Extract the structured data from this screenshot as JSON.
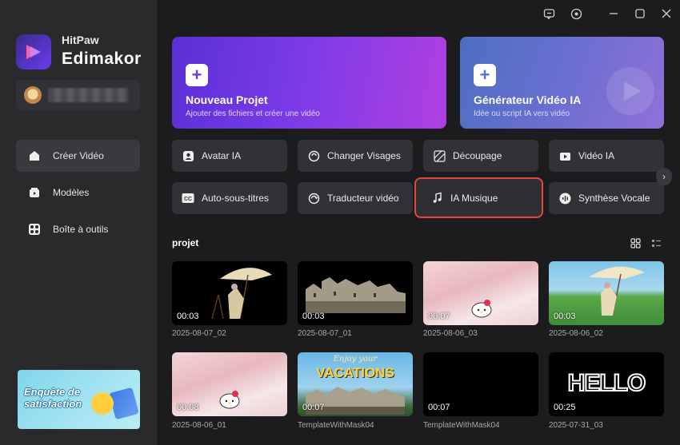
{
  "app": {
    "brand_line1": "HitPaw",
    "brand_line2": "Edimakor"
  },
  "sidebar": {
    "items": [
      {
        "label": "Créer Vidéo",
        "icon": "home-icon",
        "active": true
      },
      {
        "label": "Modèles",
        "icon": "templates-icon",
        "active": false
      },
      {
        "label": "Boîte à outils",
        "icon": "toolbox-icon",
        "active": false
      }
    ],
    "banner_text": "Enquête de satisfaction"
  },
  "titlebar": {
    "icons": [
      "feedback-icon",
      "settings-icon",
      "minimize-icon",
      "maximize-icon",
      "close-icon"
    ]
  },
  "hero": {
    "new_project": {
      "title": "Nouveau Projet",
      "subtitle": "Ajouter des fichiers et créer une vidéo"
    },
    "ai_generator": {
      "title": "Générateur Vidéo IA",
      "subtitle": "Idée ou script IA vers vidéo"
    }
  },
  "tools": {
    "row1": [
      {
        "label": "Avatar IA",
        "icon": "avatar-icon"
      },
      {
        "label": "Changer Visages",
        "icon": "face-swap-icon"
      },
      {
        "label": "Découpage",
        "icon": "cutout-icon"
      },
      {
        "label": "Vidéo IA",
        "icon": "ai-video-icon"
      }
    ],
    "row2": [
      {
        "label": "Auto-sous-titres",
        "icon": "cc-icon"
      },
      {
        "label": "Traducteur vidéo",
        "icon": "translate-icon"
      },
      {
        "label": "IA Musique",
        "icon": "music-icon",
        "highlighted": true
      },
      {
        "label": "Synthèse Vocale",
        "icon": "voice-icon"
      }
    ]
  },
  "projects": {
    "title": "projet",
    "items": [
      {
        "name": "2025-08-07_02",
        "duration": "00:03"
      },
      {
        "name": "2025-08-07_01",
        "duration": "00:03"
      },
      {
        "name": "2025-08-06_03",
        "duration": "00:07"
      },
      {
        "name": "2025-08-06_02",
        "duration": "00:03"
      },
      {
        "name": "2025-08-06_01",
        "duration": "00:08"
      },
      {
        "name": "TemplateWithMask04",
        "duration": "00:07",
        "overlay_top": "Enjoy your",
        "overlay_main": "VACATIONS"
      },
      {
        "name": "TemplateWithMask04",
        "duration": "00:07"
      },
      {
        "name": "2025-07-31_03",
        "duration": "00:25",
        "overlay_main": "HELLO"
      }
    ]
  },
  "colors": {
    "accent_purple": "#6a3cf0",
    "highlight_red": "#e0493c",
    "background": "#1c1c1e"
  }
}
